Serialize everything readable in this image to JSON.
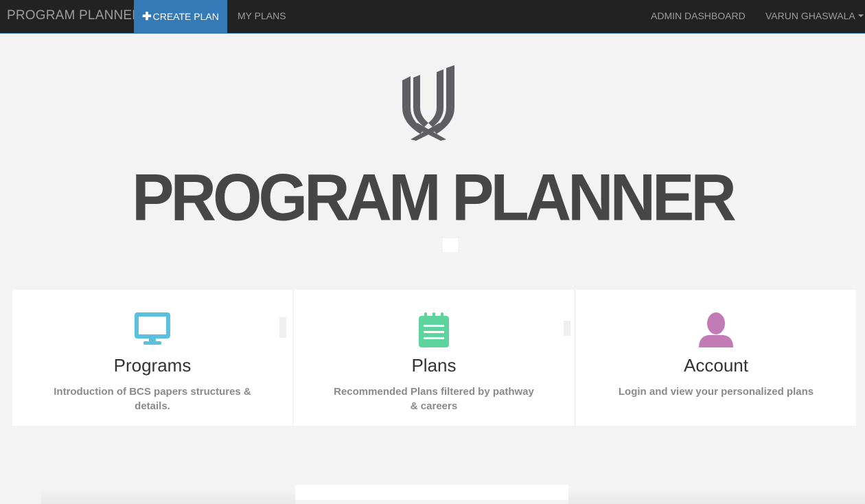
{
  "navbar": {
    "brand": "PROGRAM PLANNER",
    "create_plan_label": "CREATE PLAN",
    "create_plan_icon": "plus-icon",
    "my_plans_label": "MY PLANS",
    "admin_dashboard_label": "ADMIN DASHBOARD",
    "user_name": "VARUN GHASWALA",
    "user_menu_icon": "caret-down-icon",
    "colors": {
      "background": "#222222",
      "active_tab": "#337ab7",
      "link_text": "#9d9d9d"
    }
  },
  "hero": {
    "logo_icon": "university-shield-logo",
    "title": "PROGRAM PLANNER"
  },
  "cards": [
    {
      "title": "Programs",
      "description": "Introduction of BCS papers structures & details.",
      "icon": "monitor-icon",
      "icon_color": "#5bc0de"
    },
    {
      "title": "Plans",
      "description": "Recommended Plans filtered by pathway & careers",
      "icon": "notepad-icon",
      "icon_color": "#5dd39e"
    },
    {
      "title": "Account",
      "description": "Login and view your personalized plans",
      "icon": "user-icon",
      "icon_color": "#c27bb5"
    }
  ]
}
